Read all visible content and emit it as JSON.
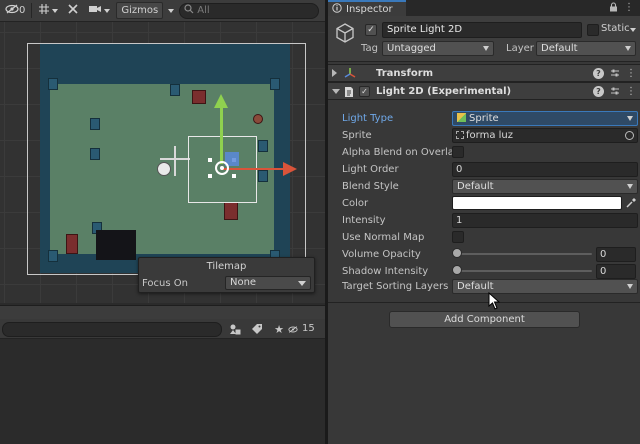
{
  "scene": {
    "toolbar": {
      "hidden_count": "0",
      "gizmos_label": "Gizmos",
      "search_placeholder": "All"
    },
    "tilemap_overlay": {
      "title": "Tilemap",
      "focus_label": "Focus On",
      "focus_value": "None"
    },
    "bottom_panel": {
      "visible_count": "15"
    }
  },
  "inspector": {
    "tab_label": "Inspector",
    "gameobject": {
      "name": "Sprite Light 2D",
      "active": true,
      "static_label": "Static",
      "tag_label": "Tag",
      "tag_value": "Untagged",
      "layer_label": "Layer",
      "layer_value": "Default"
    },
    "components": {
      "transform": {
        "title": "Transform"
      },
      "light2d": {
        "title": "Light 2D (Experimental)",
        "properties": {
          "light_type": {
            "label": "Light Type",
            "value": "Sprite"
          },
          "sprite": {
            "label": "Sprite",
            "value": "forma luz"
          },
          "alpha_blend": {
            "label": "Alpha Blend on Overlap"
          },
          "light_order": {
            "label": "Light Order",
            "value": "0"
          },
          "blend_style": {
            "label": "Blend Style",
            "value": "Default"
          },
          "color": {
            "label": "Color",
            "value": "#ffffff"
          },
          "intensity": {
            "label": "Intensity",
            "value": "1"
          },
          "use_normal_map": {
            "label": "Use Normal Map"
          },
          "volume_opacity": {
            "label": "Volume Opacity",
            "value": "0"
          },
          "shadow_intensity": {
            "label": "Shadow Intensity",
            "value": "0"
          },
          "target_sorting_layers": {
            "label": "Target Sorting Layers",
            "value": "Default"
          }
        }
      }
    },
    "add_component_label": "Add Component"
  },
  "colors": {
    "accent_blue": "#3a79bb",
    "label_blue": "#6fa8e8",
    "gizmo_green": "#8fd14f",
    "gizmo_red": "#d9543a",
    "floor": "#5a8066",
    "wall": "#1f4456"
  },
  "icons": {
    "eye": "eye-slash-icon",
    "grid": "grid-icon",
    "tools": "tools-icon",
    "camera": "camera-icon",
    "search": "search-icon",
    "lock": "lock-icon",
    "menu": "kebab-menu-icon",
    "gameobject": "cube-icon",
    "transform": "transform-axes-icon",
    "script": "script-icon",
    "help": "help-icon",
    "preset": "preset-sliders-icon",
    "eyedropper": "eyedropper-icon",
    "object_picker": "object-picker-icon"
  }
}
